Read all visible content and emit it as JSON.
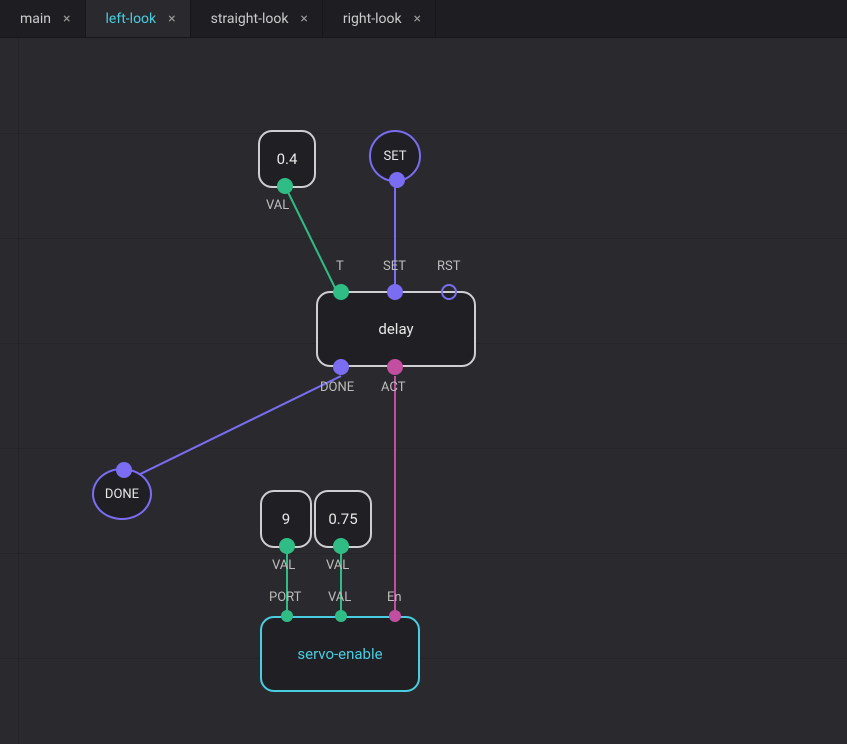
{
  "tabs": [
    {
      "label": "main",
      "active": false
    },
    {
      "label": "left-look",
      "active": true
    },
    {
      "label": "straight-look",
      "active": false
    },
    {
      "label": "right-look",
      "active": false
    }
  ],
  "nodes": {
    "const04": {
      "value": "0.4",
      "out_label": "VAL"
    },
    "set_bubble": {
      "label": "SET"
    },
    "delay": {
      "title": "delay",
      "in_t": "T",
      "in_set": "SET",
      "in_rst": "RST",
      "out_done": "DONE",
      "out_act": "ACT"
    },
    "done_bubble": {
      "label": "DONE"
    },
    "const9": {
      "value": "9",
      "out_label": "VAL"
    },
    "const075": {
      "value": "0.75",
      "out_label": "VAL"
    },
    "servo": {
      "title": "servo-enable",
      "in_port": "PORT",
      "in_val": "VAL",
      "in_en": "En"
    }
  },
  "colors": {
    "green": "#2fbd85",
    "purple": "#7b6df2",
    "magenta": "#c24e9f",
    "cyan": "#4bcde0"
  }
}
